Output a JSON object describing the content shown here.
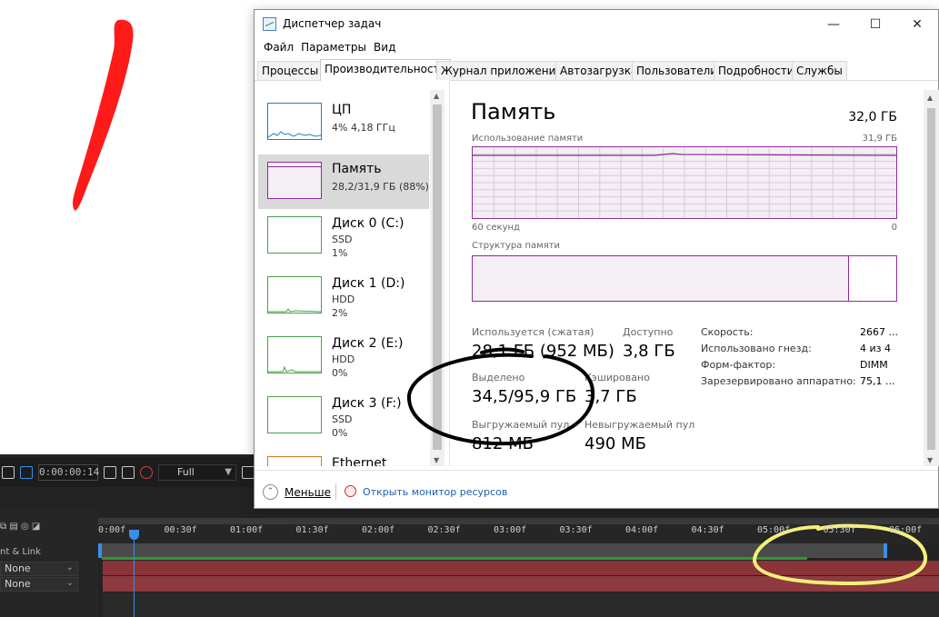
{
  "ae": {
    "timecode": "0:00:00:14",
    "resolution": "Full",
    "layer_label": "nt & Link",
    "blend_1": "None",
    "blend_2": "None",
    "ticks": [
      "0:00f",
      "00:30f",
      "01:00f",
      "01:30f",
      "02:00f",
      "02:30f",
      "03:00f",
      "03:30f",
      "04:00f",
      "04:30f",
      "05:00f",
      "05:30f",
      "06:00f"
    ]
  },
  "window": {
    "title": "Диспетчер задач",
    "minimize": "—",
    "maximize": "☐",
    "close": "✕"
  },
  "menu": [
    "Файл",
    "Параметры",
    "Вид"
  ],
  "tabs": [
    "Процессы",
    "Производительность",
    "Журнал приложений",
    "Автозагрузка",
    "Пользователи",
    "Подробности",
    "Службы"
  ],
  "sidebar": [
    {
      "name": "ЦП",
      "sub1": "4% 4,18 ГГц",
      "sub2": "",
      "color": "#1f7fbf"
    },
    {
      "name": "Память",
      "sub1": "28,2/31,9 ГБ (88%)",
      "sub2": "",
      "color": "#8b2f97"
    },
    {
      "name": "Диск 0 (C:)",
      "sub1": "SSD",
      "sub2": "1%",
      "color": "#4aa04a"
    },
    {
      "name": "Диск 1 (D:)",
      "sub1": "HDD",
      "sub2": "2%",
      "color": "#4aa04a"
    },
    {
      "name": "Диск 2 (E:)",
      "sub1": "HDD",
      "sub2": "0%",
      "color": "#4aa04a"
    },
    {
      "name": "Диск 3 (F:)",
      "sub1": "SSD",
      "sub2": "0%",
      "color": "#4aa04a"
    },
    {
      "name": "Ethernet",
      "sub1": "",
      "sub2": "",
      "color": "#c97a2b"
    }
  ],
  "memory": {
    "title": "Память",
    "total": "32,0 ГБ",
    "usage_label": "Использование памяти",
    "usage_max": "31,9 ГБ",
    "axis_left": "60 секунд",
    "axis_right": "0",
    "structure_label": "Структура памяти",
    "in_use_label": "Используется (сжатая)",
    "in_use_value": "28,1 ГБ (952 МБ)",
    "available_label": "Доступно",
    "available_value": "3,8 ГБ",
    "committed_label": "Выделено",
    "committed_value": "34,5/95,9 ГБ",
    "cached_label": "Кэшировано",
    "cached_value": "3,7 ГБ",
    "paged_label": "Выгружаемый пул",
    "paged_value": "812 МБ",
    "nonpaged_label": "Невыгружаемый пул",
    "nonpaged_value": "490 МБ",
    "specs": [
      {
        "key": "Скорость:",
        "value": "2667 ..."
      },
      {
        "key": "Использовано гнезд:",
        "value": "4 из 4"
      },
      {
        "key": "Форм-фактор:",
        "value": "DIMM"
      },
      {
        "key": "Зарезервировано аппаратно:",
        "value": "75,1 ..."
      }
    ]
  },
  "footer": {
    "fewer": "Меньше",
    "monitor": "Открыть монитор ресурсов"
  }
}
